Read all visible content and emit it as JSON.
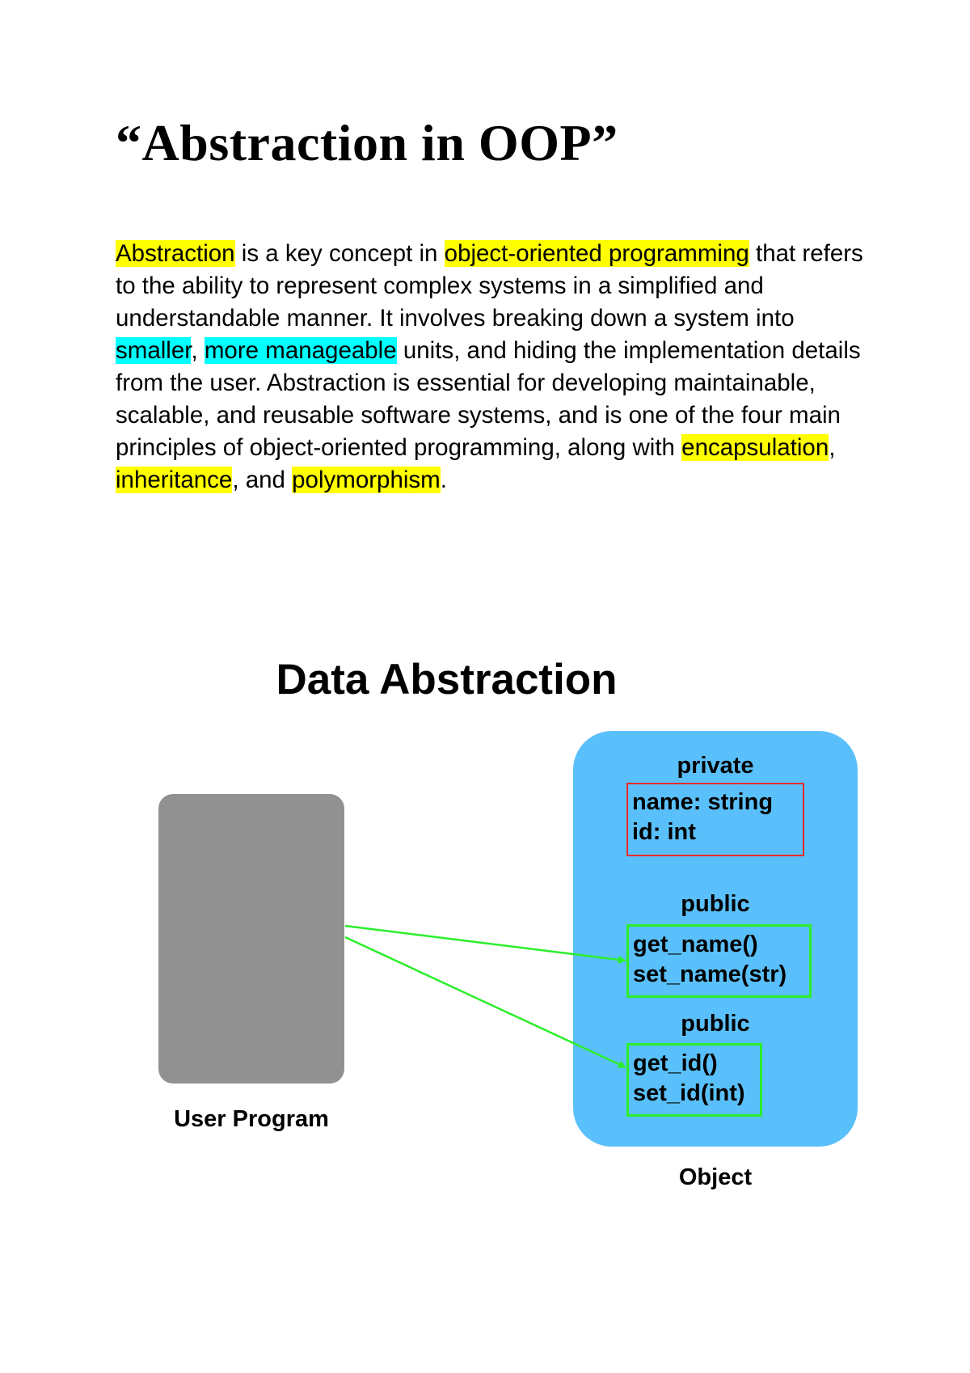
{
  "document": {
    "title": "“Abstraction in OOP”",
    "paragraph": [
      {
        "text": "Abstraction",
        "highlight": "yellow"
      },
      {
        "text": " is a key concept in ",
        "highlight": null
      },
      {
        "text": "object-oriented programming",
        "highlight": "yellow"
      },
      {
        "text": " that refers to the ability to represent complex systems in a simplified and understandable manner. It involves breaking down a system into ",
        "highlight": null
      },
      {
        "text": "smaller",
        "highlight": "cyan"
      },
      {
        "text": ", ",
        "highlight": null
      },
      {
        "text": "more manageable",
        "highlight": "cyan"
      },
      {
        "text": " units, and hiding the implementation details from the user. Abstraction is essential for developing maintainable, scalable, and reusable software systems, and is one of the four main principles of object-oriented programming, along with ",
        "highlight": null
      },
      {
        "text": "encapsulation",
        "highlight": "yellow"
      },
      {
        "text": ", ",
        "highlight": null
      },
      {
        "text": "inheritance",
        "highlight": "yellow"
      },
      {
        "text": ", and ",
        "highlight": null
      },
      {
        "text": "polymorphism",
        "highlight": "yellow"
      },
      {
        "text": ".",
        "highlight": null
      }
    ],
    "highlight_colors": {
      "yellow": "#ffff00",
      "cyan": "#00ffff"
    }
  },
  "diagram": {
    "title": "Data Abstraction",
    "user_program_label": "User Program",
    "object_label": "Object",
    "sections": [
      {
        "label": "private",
        "members": [
          "name: string",
          "id: int"
        ],
        "border_color": "#ee2a2a"
      },
      {
        "label": "public",
        "members": [
          "get_name()",
          "set_name(str)"
        ],
        "border_color": "#2bee2b"
      },
      {
        "label": "public",
        "members": [
          "get_id()",
          "set_id(int)"
        ],
        "border_color": "#2bee2b"
      }
    ],
    "colors": {
      "user_program_fill": "#919191",
      "object_fill": "#5ac0fb",
      "arrow": "#2bee2b"
    }
  }
}
